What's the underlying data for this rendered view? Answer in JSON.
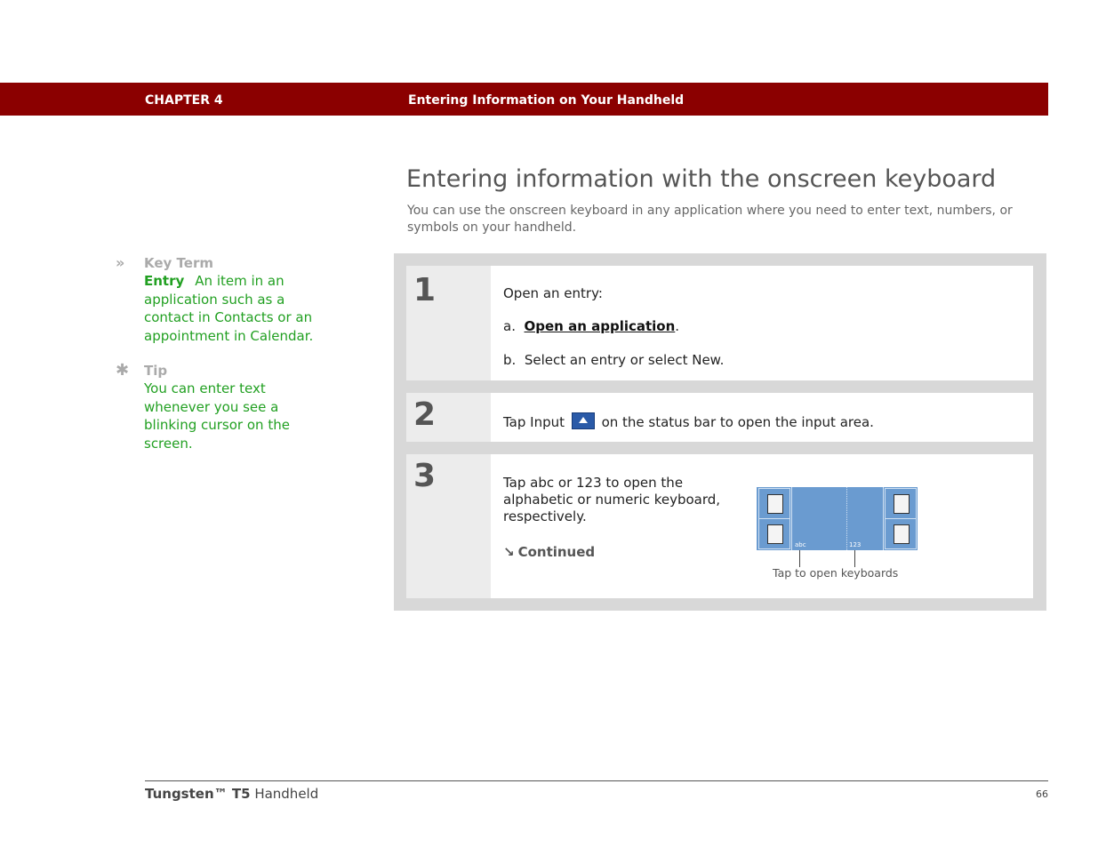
{
  "header": {
    "chapter": "CHAPTER 4",
    "chapter_title": "Entering Information on Your Handheld"
  },
  "page": {
    "title": "Entering information with the onscreen keyboard",
    "intro": "You can use the onscreen keyboard in any application where you need to enter text, numbers, or symbols on your handheld."
  },
  "sidebar": {
    "key_term": {
      "kicker": "»",
      "heading": "Key Term",
      "term": "Entry",
      "definition": "An item in an application such as a contact in Contacts or an appointment in Calendar."
    },
    "tip": {
      "kicker": "✱",
      "heading": "Tip",
      "body": "You can enter text whenever you see a blinking cursor on the screen."
    }
  },
  "steps": [
    {
      "number": "1",
      "lead": "Open an entry:",
      "a_prefix": "a.",
      "a_link": "Open an application",
      "a_suffix": ".",
      "b_prefix": "b.",
      "b_text": "Select an entry or select New."
    },
    {
      "number": "2",
      "text_before": "Tap Input",
      "text_after": "on the status bar to open the input area."
    },
    {
      "number": "3",
      "text": "Tap abc or 123 to open the alphabetic or numeric keyboard, respectively.",
      "continued": "Continued",
      "figure_abc": "abc",
      "figure_123": "123",
      "figure_caption": "Tap to open keyboards"
    }
  ],
  "footer": {
    "product_bold": "Tungsten™ T5",
    "product_rest": "Handheld",
    "page_number": "66"
  },
  "colors": {
    "header_bar": "#8b0000",
    "sidebar_text": "#22a022",
    "figure_blue": "#6a9bd0"
  }
}
